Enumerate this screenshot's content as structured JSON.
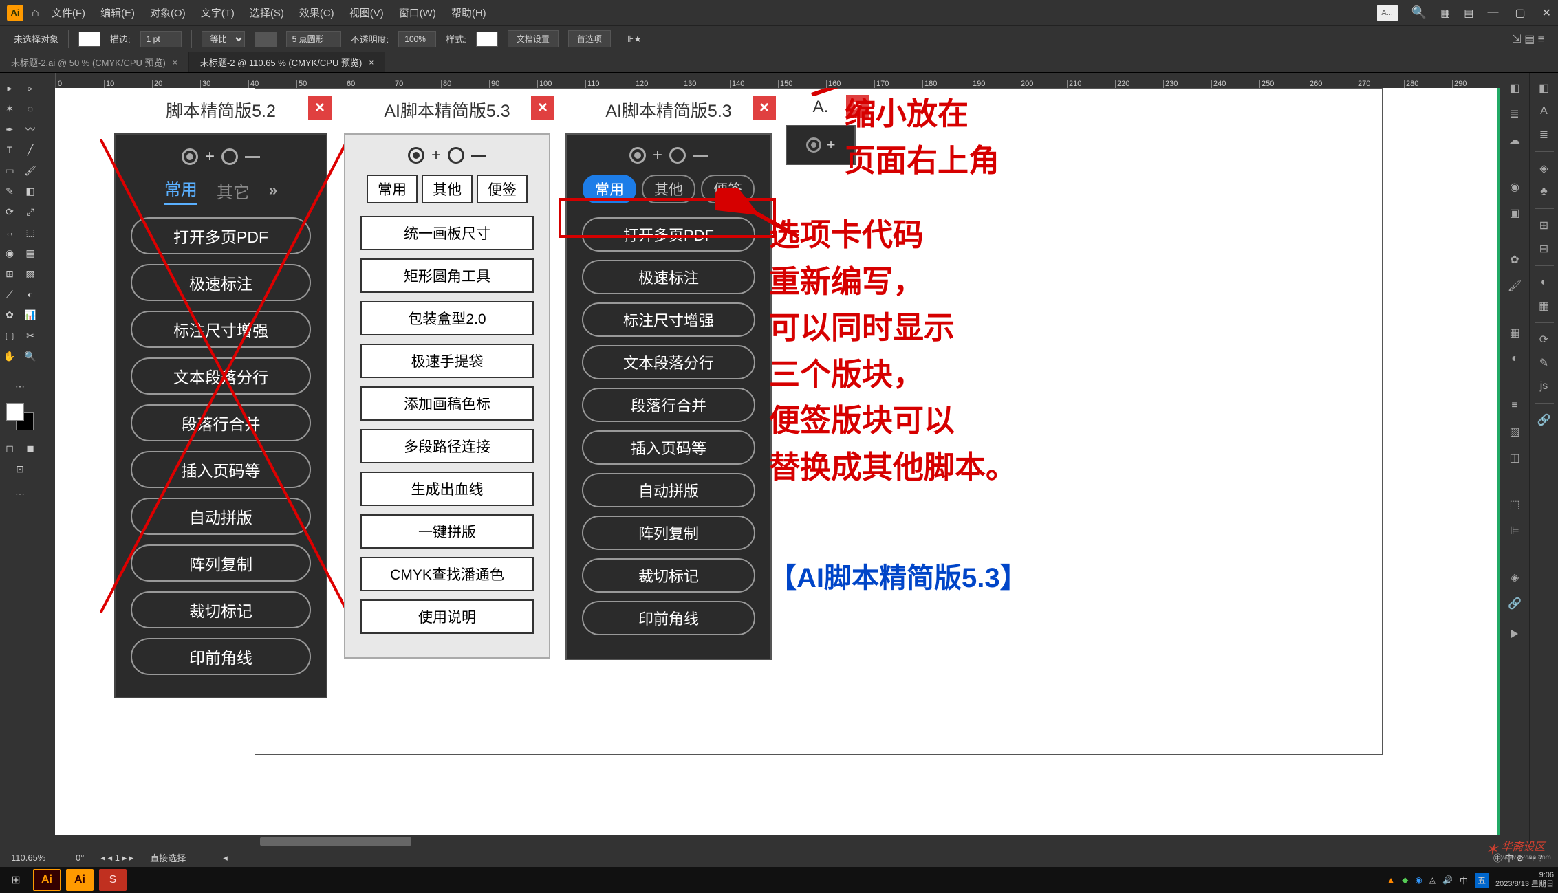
{
  "menu": {
    "items": [
      "文件(F)",
      "编辑(E)",
      "对象(O)",
      "文字(T)",
      "选择(S)",
      "效果(C)",
      "视图(V)",
      "窗口(W)",
      "帮助(H)"
    ],
    "search_placeholder": "A..."
  },
  "options": {
    "selection_label": "未选择对象",
    "stroke_label": "描边:",
    "stroke_value": "1 pt",
    "uniform_label": "等比",
    "brush_value": "5 点圆形",
    "opacity_label": "不透明度:",
    "opacity_value": "100%",
    "style_label": "样式:",
    "doc_setup": "文档设置",
    "prefs": "首选项"
  },
  "tabs": {
    "tab1": "未标题-2.ai @ 50 % (CMYK/CPU 预览)",
    "tab2": "未标题-2 @ 110.65 % (CMYK/CPU 预览)"
  },
  "ruler_ticks": [
    "0",
    "10",
    "20",
    "30",
    "40",
    "50",
    "60",
    "70",
    "80",
    "90",
    "100",
    "110",
    "120",
    "130",
    "140",
    "150",
    "160",
    "170",
    "180",
    "190",
    "200",
    "210",
    "220",
    "230",
    "240",
    "250",
    "260",
    "270",
    "280",
    "290"
  ],
  "panel1": {
    "title": "脚本精简版5.2",
    "tabs": {
      "t1": "常用",
      "t2": "其它",
      "more": "»"
    },
    "buttons": [
      "打开多页PDF",
      "极速标注",
      "标注尺寸增强",
      "文本段落分行",
      "段落行合并",
      "插入页码等",
      "自动拼版",
      "阵列复制",
      "裁切标记",
      "印前角线"
    ]
  },
  "panel2": {
    "title": "AI脚本精简版5.3",
    "tabs": [
      "常用",
      "其他",
      "便签"
    ],
    "buttons": [
      "统一画板尺寸",
      "矩形圆角工具",
      "包装盒型2.0",
      "极速手提袋",
      "添加画稿色标",
      "多段路径连接",
      "生成出血线",
      "一键拼版",
      "CMYK查找潘通色",
      "使用说明"
    ]
  },
  "panel3": {
    "title": "AI脚本精简版5.3",
    "tabs": [
      "常用",
      "其他",
      "便签"
    ],
    "buttons": [
      "打开多页PDF",
      "极速标注",
      "标注尺寸增强",
      "文本段落分行",
      "段落行合并",
      "插入页码等",
      "自动拼版",
      "阵列复制",
      "裁切标记",
      "印前角线"
    ]
  },
  "panel4": {
    "title": "A."
  },
  "annotation1": {
    "line1": "缩小放在",
    "line2": "页面右上角"
  },
  "annotation2": {
    "l1": "选项卡代码",
    "l2": "重新编写，",
    "l3": "可以同时显示",
    "l4": "三个版块，",
    "l5": "便签版块可以",
    "l6": "替换成其他脚本。"
  },
  "annotation_blue": "【AI脚本精简版5.3】",
  "status": {
    "zoom": "110.65%",
    "rotate": "0°",
    "artboard": "1",
    "tool": "直接选择"
  },
  "taskbar": {
    "time": "9:06",
    "date": "2023/8/13 星期日"
  },
  "watermark": "华裔设区",
  "watermark_url": "www.52cnp.com"
}
